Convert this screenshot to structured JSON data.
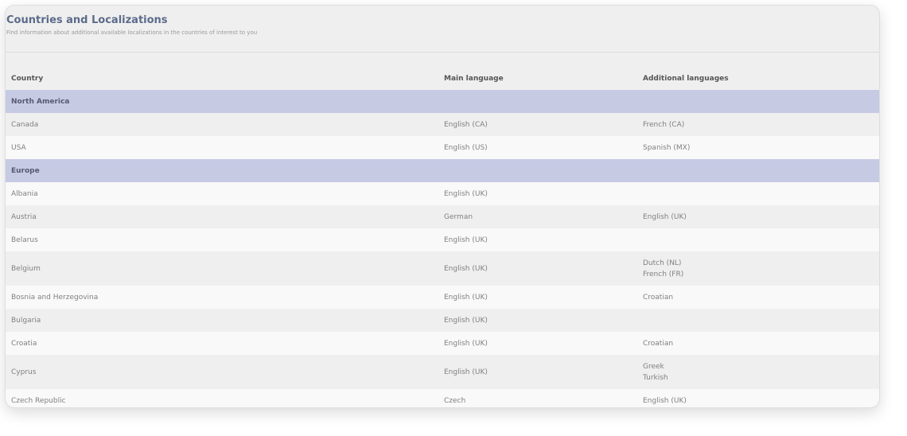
{
  "header": {
    "title": "Countries and Localizations",
    "subtitle": "Find information about additional available localizations in the countries of interest to you"
  },
  "columns": {
    "country": "Country",
    "main_language": "Main language",
    "additional_languages": "Additional languages"
  },
  "groups": [
    {
      "name": "North America",
      "rows": [
        {
          "country": "Canada",
          "main": "English (CA)",
          "additional": [
            "French (CA)"
          ]
        },
        {
          "country": "USA",
          "main": "English (US)",
          "additional": [
            "Spanish (MX)"
          ]
        }
      ]
    },
    {
      "name": "Europe",
      "rows": [
        {
          "country": "Albania",
          "main": "English (UK)",
          "additional": []
        },
        {
          "country": "Austria",
          "main": "German",
          "additional": [
            "English (UK)"
          ]
        },
        {
          "country": "Belarus",
          "main": "English (UK)",
          "additional": []
        },
        {
          "country": "Belgium",
          "main": "English (UK)",
          "additional": [
            "Dutch (NL)",
            "French (FR)"
          ]
        },
        {
          "country": "Bosnia and Herzegovina",
          "main": "English (UK)",
          "additional": [
            "Croatian"
          ]
        },
        {
          "country": "Bulgaria",
          "main": "English (UK)",
          "additional": []
        },
        {
          "country": "Croatia",
          "main": "English (UK)",
          "additional": [
            "Croatian"
          ]
        },
        {
          "country": "Cyprus",
          "main": "English (UK)",
          "additional": [
            "Greek",
            "Turkish"
          ]
        },
        {
          "country": "Czech Republic",
          "main": "Czech",
          "additional": [
            "English (UK)"
          ]
        }
      ]
    }
  ]
}
